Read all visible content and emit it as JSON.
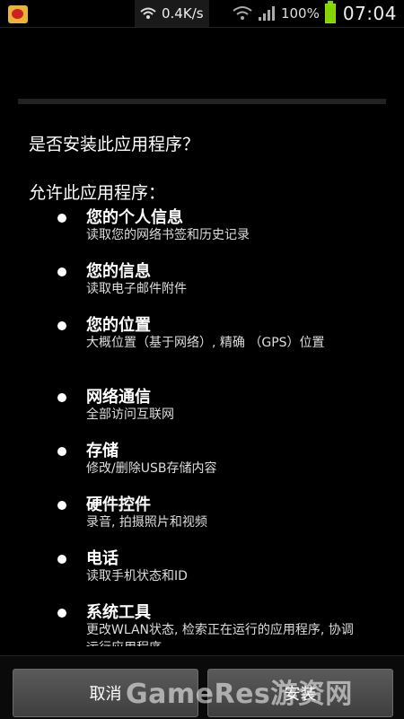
{
  "status_bar": {
    "app_icon": "weibo-icon",
    "wifi_icon": "wifi-updown-icon",
    "network_speed": "0.4K/s",
    "signal_icon": "cell-signal-icon",
    "battery_percent": "100%",
    "battery_icon": "battery-icon",
    "time": "07:04"
  },
  "dialog": {
    "question": "是否安装此应用程序？",
    "allow_label": "允许此应用程序：",
    "permissions": [
      {
        "title": "您的个人信息",
        "desc": "读取您的网络书签和历史记录"
      },
      {
        "title": "您的信息",
        "desc": "读取电子邮件附件"
      },
      {
        "title": "您的位置",
        "desc": "大概位置（基于网络）, 精确 （GPS）位置"
      },
      {
        "title": "网络通信",
        "desc": "全部访问互联网"
      },
      {
        "title": "存储",
        "desc": "修改/删除USB存储内容"
      },
      {
        "title": "硬件控件",
        "desc": "录音, 拍摄照片和视频"
      },
      {
        "title": "电话",
        "desc": "读取手机状态和ID"
      },
      {
        "title": "系统工具",
        "desc": "更改WLAN状态, 检索正在运行的应用程序, 协调运行应用程序"
      }
    ]
  },
  "buttons": {
    "cancel": "取消",
    "install": "安装"
  },
  "watermark": "GameRes游资网",
  "colors": {
    "background": "#000000",
    "battery": "#84d400",
    "button": "#4a4a4a"
  }
}
